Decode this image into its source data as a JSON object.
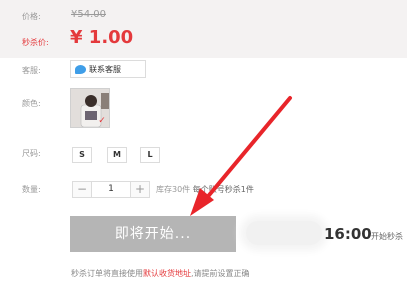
{
  "price": {
    "original_label": "价格:",
    "original_value": "¥54.00",
    "sale_label": "秒杀价:",
    "sale_value": "¥ 1.00"
  },
  "customer_service": {
    "label": "客服:",
    "button": "联系客服",
    "icon": "chat-bubble-icon"
  },
  "color": {
    "label": "颜色:"
  },
  "size": {
    "label": "尺码:",
    "options": [
      "S",
      "M",
      "L"
    ]
  },
  "quantity": {
    "label": "数量:",
    "minus": "−",
    "value": "1",
    "plus": "+",
    "stock": "库存30件",
    "limit": "每个账号秒杀1件"
  },
  "action": {
    "button": "即将开始...",
    "time": "16:00",
    "time_suffix": "开始秒杀"
  },
  "note": {
    "prefix": "秒杀订单将直接使用",
    "link": "默认收货地址",
    "suffix": ",请提前设置正确"
  },
  "colors": {
    "accent": "#e4393c",
    "button_disabled": "#b5b5b5",
    "arrow": "#e8252a"
  }
}
